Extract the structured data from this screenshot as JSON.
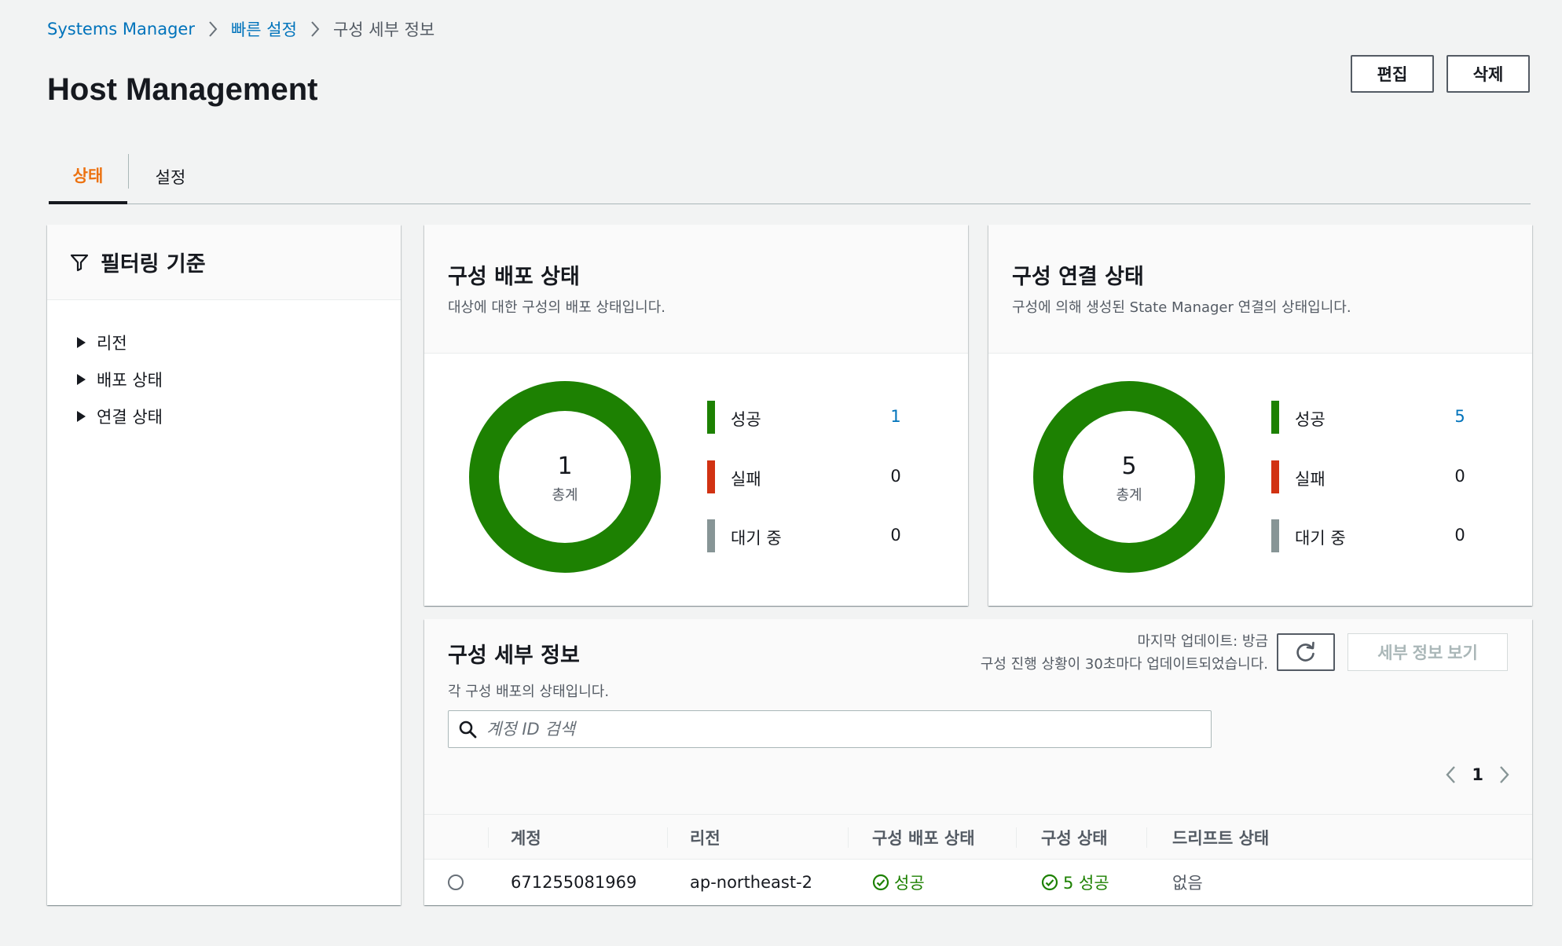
{
  "breadcrumb": {
    "items": [
      "Systems Manager",
      "빠른 설정",
      "구성 세부 정보"
    ]
  },
  "page": {
    "title": "Host Management",
    "edit_label": "편집",
    "delete_label": "삭제"
  },
  "tabs": [
    {
      "label": "상태",
      "active": true
    },
    {
      "label": "설정",
      "active": false
    }
  ],
  "filter": {
    "title": "필터링 기준",
    "items": [
      "리전",
      "배포 상태",
      "연결 상태"
    ]
  },
  "deploy_status": {
    "title": "구성 배포 상태",
    "description": "대상에 대한 구성의 배포 상태입니다.",
    "total": "1",
    "total_label": "총계",
    "legend": [
      {
        "label": "성공",
        "value": "1",
        "color": "#1d8102"
      },
      {
        "label": "실패",
        "value": "0",
        "color": "#d13212"
      },
      {
        "label": "대기 중",
        "value": "0",
        "color": "#879596"
      }
    ]
  },
  "assoc_status": {
    "title": "구성 연결 상태",
    "description": "구성에 의해 생성된 State Manager 연결의 상태입니다.",
    "total": "5",
    "total_label": "총계",
    "legend": [
      {
        "label": "성공",
        "value": "5",
        "color": "#1d8102"
      },
      {
        "label": "실패",
        "value": "0",
        "color": "#d13212"
      },
      {
        "label": "대기 중",
        "value": "0",
        "color": "#879596"
      }
    ]
  },
  "details": {
    "title": "구성 세부 정보",
    "description": "각 구성 배포의 상태입니다.",
    "last_updated": "마지막 업데이트: 방금",
    "update_note": "구성 진행 상황이 30초마다 업데이트되었습니다.",
    "view_details_label": "세부 정보 보기",
    "search_placeholder": "계정 ID 검색",
    "page_number": "1",
    "columns": [
      "계정",
      "리전",
      "구성 배포 상태",
      "구성 상태",
      "드리프트 상태"
    ],
    "rows": [
      {
        "account": "671255081969",
        "region": "ap-northeast-2",
        "deploy_status": "성공",
        "config_status": "5 성공",
        "drift_status": "없음"
      }
    ]
  },
  "colors": {
    "accent": "#ec7211",
    "link": "#0073bb",
    "success": "#1d8102",
    "error": "#d13212",
    "pending": "#879596"
  }
}
